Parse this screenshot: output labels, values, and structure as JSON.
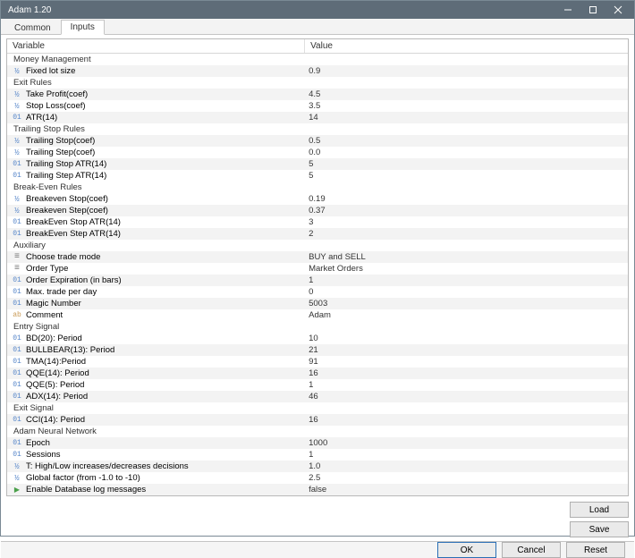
{
  "window": {
    "title": "Adam 1.20"
  },
  "tabs": {
    "common": "Common",
    "inputs": "Inputs"
  },
  "grid": {
    "header_variable": "Variable",
    "header_value": "Value"
  },
  "buttons": {
    "load": "Load",
    "save": "Save",
    "ok": "OK",
    "cancel": "Cancel",
    "reset": "Reset"
  },
  "rows": [
    {
      "section": true,
      "label": "Money Management"
    },
    {
      "type": "dbl",
      "label": "Fixed lot size",
      "value": "0.9"
    },
    {
      "section": true,
      "label": "Exit Rules"
    },
    {
      "type": "dbl",
      "label": "Take Profit(coef)",
      "value": "4.5"
    },
    {
      "type": "dbl",
      "label": "Stop Loss(coef)",
      "value": "3.5"
    },
    {
      "type": "int",
      "label": "ATR(14)",
      "value": "14"
    },
    {
      "section": true,
      "label": "Trailing Stop Rules"
    },
    {
      "type": "dbl",
      "label": "Trailing Stop(coef)",
      "value": "0.5"
    },
    {
      "type": "dbl",
      "label": "Trailing Step(coef)",
      "value": "0.0"
    },
    {
      "type": "int",
      "label": "Trailing Stop ATR(14)",
      "value": "5"
    },
    {
      "type": "int",
      "label": "Trailing Step ATR(14)",
      "value": "5"
    },
    {
      "section": true,
      "label": "Break-Even Rules"
    },
    {
      "type": "dbl",
      "label": "Breakeven Stop(coef)",
      "value": "0.19"
    },
    {
      "type": "dbl",
      "label": "Breakeven Step(coef)",
      "value": "0.37"
    },
    {
      "type": "int",
      "label": "BreakEven Stop ATR(14)",
      "value": "3"
    },
    {
      "type": "int",
      "label": "BreakEven Step ATR(14)",
      "value": "2"
    },
    {
      "section": true,
      "label": "Auxiliary"
    },
    {
      "type": "enum",
      "label": "Choose trade mode",
      "value": "BUY and SELL"
    },
    {
      "type": "enum",
      "label": "Order Type",
      "value": "Market Orders"
    },
    {
      "type": "int",
      "label": "Order Expiration (in bars)",
      "value": "1"
    },
    {
      "type": "int",
      "label": "Max. trade per day",
      "value": "0"
    },
    {
      "type": "int",
      "label": "Magic Number",
      "value": "5003"
    },
    {
      "type": "str",
      "label": "Comment",
      "value": "Adam"
    },
    {
      "section": true,
      "label": "Entry Signal"
    },
    {
      "type": "int",
      "label": "BD(20): Period",
      "value": "10"
    },
    {
      "type": "int",
      "label": "BULLBEAR(13): Period",
      "value": "21"
    },
    {
      "type": "int",
      "label": "TMA(14):Period",
      "value": "91"
    },
    {
      "type": "int",
      "label": "QQE(14): Period",
      "value": "16"
    },
    {
      "type": "int",
      "label": "QQE(5): Period",
      "value": "1"
    },
    {
      "type": "int",
      "label": "ADX(14): Period",
      "value": "46"
    },
    {
      "section": true,
      "label": "Exit Signal"
    },
    {
      "type": "int",
      "label": "CCI(14): Period",
      "value": "16"
    },
    {
      "section": true,
      "label": "Adam Neural Network"
    },
    {
      "type": "int",
      "label": "Epoch",
      "value": "1000"
    },
    {
      "type": "int",
      "label": "Sessions",
      "value": "1"
    },
    {
      "type": "dbl",
      "label": "T: High/Low increases/decreases decisions",
      "value": "1.0"
    },
    {
      "type": "dbl",
      "label": "Global factor (from  -1.0 to -10)",
      "value": "2.5"
    },
    {
      "type": "bool",
      "label": "Enable Database log messages",
      "value": "false"
    }
  ]
}
